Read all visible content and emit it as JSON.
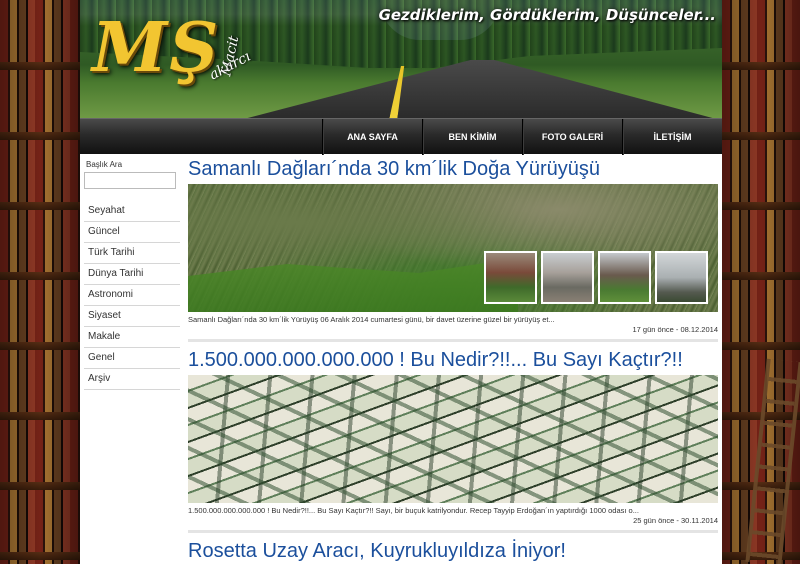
{
  "header": {
    "logo_text": "MŞ",
    "logo_sub1": "akarcı",
    "logo_sub2": "Macit",
    "tagline": "Gezdiklerim, Gördüklerim, Düşünceler..."
  },
  "nav": {
    "items": [
      {
        "label": "ANA SAYFA"
      },
      {
        "label": "BEN KİMİM"
      },
      {
        "label": "FOTO GALERİ"
      },
      {
        "label": "İLETİŞİM"
      }
    ]
  },
  "sidebar": {
    "search_label": "Başlık Ara",
    "search_value": "",
    "categories": [
      {
        "label": "Seyahat"
      },
      {
        "label": "Güncel"
      },
      {
        "label": "Türk Tarihi"
      },
      {
        "label": "Dünya Tarihi"
      },
      {
        "label": "Astronomi"
      },
      {
        "label": "Siyaset"
      },
      {
        "label": "Makale"
      },
      {
        "label": "Genel"
      },
      {
        "label": "Arşiv"
      }
    ]
  },
  "posts": [
    {
      "title": "Samanlı Dağları´nda 30 km´lik Doğa Yürüyüşü",
      "excerpt": "Samanlı Dağları´nda 30 km´lik Yürüyüş 06 Aralık 2014 cumartesi günü, bir davet üzerine güzel bir yürüyüş et...",
      "meta": "17 gün önce - 08.12.2014"
    },
    {
      "title": "1.500.000.000.000.000 ! Bu Nedir?!!... Bu Sayı Kaçtır?!!",
      "excerpt": "1.500.000.000.000.000 ! Bu Nedir?!!... Bu Sayı Kaçtır?!! Sayı, bir buçuk katrilyondur. Recep Tayyip Erdoğan´ın yaptırdığı 1000 odası o...",
      "meta": "25 gün önce - 30.11.2014"
    },
    {
      "title": "Rosetta Uzay Aracı, Kuyrukluyıldıza İniyor!"
    }
  ]
}
